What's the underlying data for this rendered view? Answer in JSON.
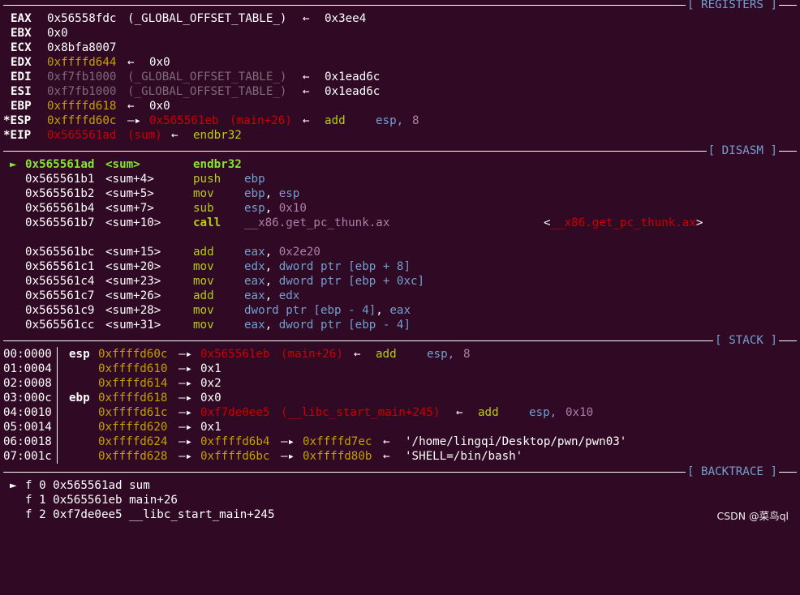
{
  "sections": {
    "registers": "[ REGISTERS ]",
    "disasm": "[ DISASM ]",
    "stack": "[ STACK ]",
    "backtrace": "[ BACKTRACE ]"
  },
  "registers": [
    {
      "name": "EAX",
      "value": "0x56558fdc",
      "sym": "(_GLOBAL_OFFSET_TABLE_)",
      "arrow": "←",
      "target": "0x3ee4"
    },
    {
      "name": "EBX",
      "value": "0x0"
    },
    {
      "name": "ECX",
      "value": "0x8bfa8007"
    },
    {
      "name": "EDX",
      "value": "0xffffd644",
      "arrow": "←",
      "target": "0x0"
    },
    {
      "name": "EDI",
      "value": "0xf7fb1000",
      "sym": "(_GLOBAL_OFFSET_TABLE_)",
      "arrow": "←",
      "target": "0x1ead6c"
    },
    {
      "name": "ESI",
      "value": "0xf7fb1000",
      "sym": "(_GLOBAL_OFFSET_TABLE_)",
      "arrow": "←",
      "target": "0x1ead6c"
    },
    {
      "name": "EBP",
      "value": "0xffffd618",
      "arrow": "←",
      "target": "0x0"
    },
    {
      "name": "*ESP",
      "value": "0xffffd60c",
      "arrow1": "—▸",
      "ptr": "0x565561eb",
      "sym": "(main+26)",
      "arrow": "←",
      "op": "add",
      "args1": "esp,",
      "args2": "8"
    },
    {
      "name": "*EIP",
      "value": "0x565561ad",
      "sym": "(sum)",
      "arrow": "←",
      "op": "endbr32"
    }
  ],
  "disasm": [
    {
      "marker": "►",
      "addr": "0x565561ad",
      "sym": "<sum>",
      "op": "endbr32",
      "args": ""
    },
    {
      "addr": "0x565561b1",
      "sym": "<sum+4>",
      "op": "push",
      "args": "ebp"
    },
    {
      "addr": "0x565561b2",
      "sym": "<sum+5>",
      "op": "mov",
      "args_a": "ebp",
      "args_b": ", ",
      "args_c": "esp"
    },
    {
      "addr": "0x565561b4",
      "sym": "<sum+7>",
      "op": "sub",
      "args_a": "esp",
      "args_b": ", ",
      "args_c": "0x10"
    },
    {
      "addr": "0x565561b7",
      "sym": "<sum+10>",
      "op": "call",
      "args": "__x86.get_pc_thunk.ax",
      "target_open": "<",
      "target": "__x86.get_pc_thunk.ax",
      "target_close": ">"
    },
    {
      "addr": "0x565561bc",
      "sym": "<sum+15>",
      "op": "add",
      "args_a": "eax",
      "args_b": ", ",
      "args_c": "0x2e20"
    },
    {
      "addr": "0x565561c1",
      "sym": "<sum+20>",
      "op": "mov",
      "args_a": "edx",
      "args_b": ", ",
      "args_c": "dword ptr [ebp + 8]"
    },
    {
      "addr": "0x565561c4",
      "sym": "<sum+23>",
      "op": "mov",
      "args_a": "eax",
      "args_b": ", ",
      "args_c": "dword ptr [ebp + 0xc]"
    },
    {
      "addr": "0x565561c7",
      "sym": "<sum+26>",
      "op": "add",
      "args_a": "eax",
      "args_b": ", ",
      "args_c": "edx"
    },
    {
      "addr": "0x565561c9",
      "sym": "<sum+28>",
      "op": "mov",
      "args_a": "dword ptr [ebp - 4]",
      "args_b": ", ",
      "args_c": "eax"
    },
    {
      "addr": "0x565561cc",
      "sym": "<sum+31>",
      "op": "mov",
      "args_a": "eax",
      "args_b": ", ",
      "args_c": "dword ptr [ebp - 4]"
    }
  ],
  "stack": [
    {
      "idx": "00:0000",
      "reg": "esp",
      "addr": "0xffffd60c",
      "a1": "—▸",
      "v1": "0x565561eb",
      "sym": "(main+26)",
      "a2": "←",
      "op": "add",
      "args1": "esp,",
      "args2": "8"
    },
    {
      "idx": "01:0004",
      "addr": "0xffffd610",
      "a1": "—▸",
      "v1": "0x1"
    },
    {
      "idx": "02:0008",
      "addr": "0xffffd614",
      "a1": "—▸",
      "v1": "0x2"
    },
    {
      "idx": "03:000c",
      "reg": "ebp",
      "addr": "0xffffd618",
      "a1": "—▸",
      "v1": "0x0"
    },
    {
      "idx": "04:0010",
      "addr": "0xffffd61c",
      "a1": "—▸",
      "v1": "0xf7de0ee5",
      "sym": "(__libc_start_main+245)",
      "a2": "←",
      "op": "add",
      "args1": "esp,",
      "args2": "0x10"
    },
    {
      "idx": "05:0014",
      "addr": "0xffffd620",
      "a1": "—▸",
      "v1": "0x1"
    },
    {
      "idx": "06:0018",
      "addr": "0xffffd624",
      "a1": "—▸",
      "v1": "0xffffd6b4",
      "a2": "—▸",
      "v2": "0xffffd7ec",
      "a3": "←",
      "str": "'/home/lingqi/Desktop/pwn/pwn03'"
    },
    {
      "idx": "07:001c",
      "addr": "0xffffd628",
      "a1": "—▸",
      "v1": "0xffffd6bc",
      "a2": "—▸",
      "v2": "0xffffd80b",
      "a3": "←",
      "str": "'SHELL=/bin/bash'"
    }
  ],
  "backtrace": [
    {
      "marker": "►",
      "text": "f 0 0x565561ad sum"
    },
    {
      "text": "f 1 0x565561eb main+26"
    },
    {
      "text": "f 2 0xf7de0ee5 __libc_start_main+245"
    }
  ],
  "watermark": "CSDN @菜鸟ql",
  "colors": {
    "background": "#300a24",
    "yellow": "#c4a000",
    "red": "#cc0000",
    "green": "#b5cc18",
    "purple": "#ad7fa8",
    "blue": "#729fcf"
  }
}
